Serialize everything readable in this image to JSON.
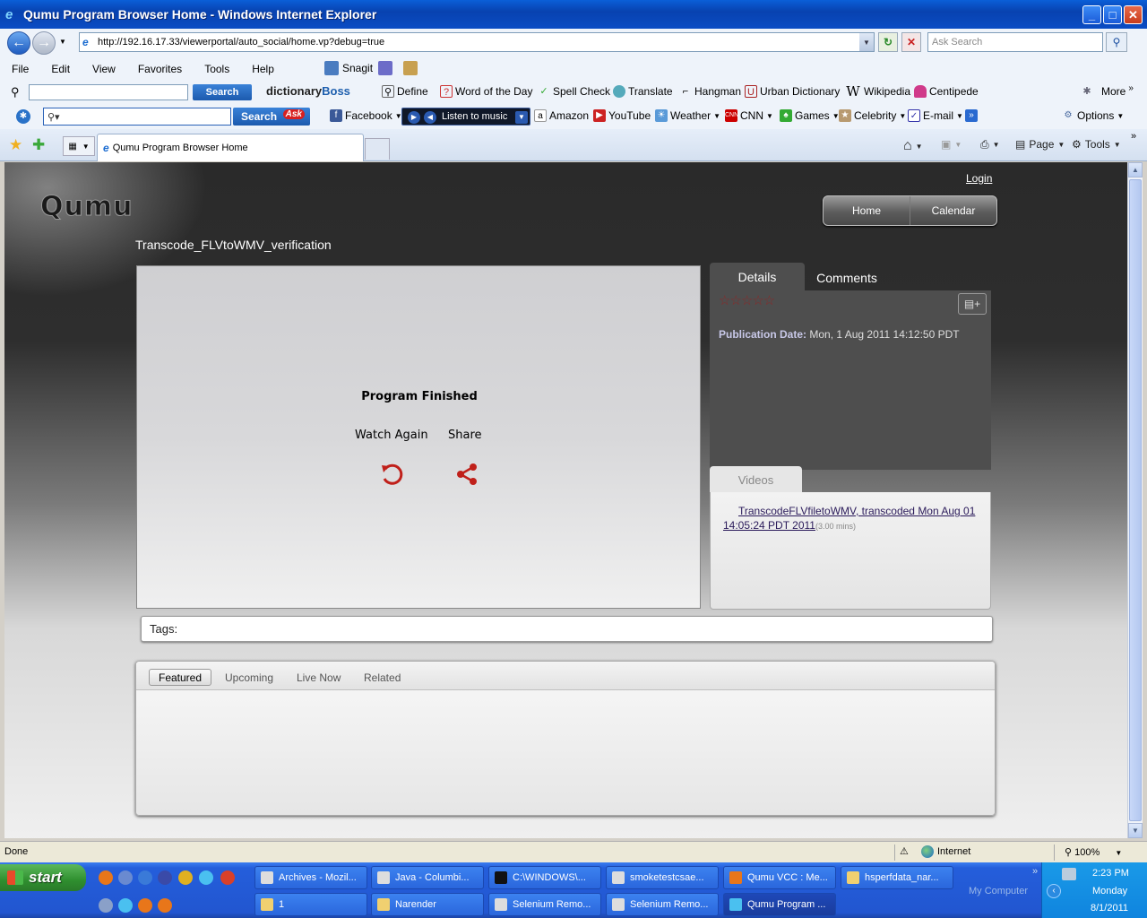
{
  "window": {
    "title": "Qumu Program Browser Home - Windows Internet Explorer",
    "minimize": "_",
    "maximize": "□",
    "close": "✕"
  },
  "addressbar": {
    "url": "http://192.16.17.33/viewerportal/auto_social/home.vp?debug=true",
    "search_placeholder": "Ask Search"
  },
  "menu": [
    "File",
    "Edit",
    "View",
    "Favorites",
    "Tools",
    "Help"
  ],
  "snagit_label": "Snagit",
  "dict_toolbar": {
    "search_button": "Search",
    "brand_a": "dictionary",
    "brand_b": "Boss",
    "tools": [
      "Define",
      "Word of the Day",
      "Spell Check",
      "Translate",
      "Hangman",
      "Urban Dictionary",
      "Wikipedia",
      "Centipede"
    ],
    "more": "More"
  },
  "ask_toolbar": {
    "search_button": "Search",
    "ask_badge": "Ask",
    "facebook": "Facebook",
    "music": "Listen to music",
    "links": [
      "Amazon",
      "YouTube",
      "Weather",
      "CNN",
      "Games",
      "Celebrity",
      "E-mail"
    ],
    "options": "Options"
  },
  "tabbar": {
    "tab_title": "Qumu Program Browser Home",
    "page": "Page",
    "tools": "Tools"
  },
  "page": {
    "logo": "Qumu",
    "login": "Login",
    "nav": [
      "Home",
      "Calendar"
    ],
    "program_title": "Transcode_FLVtoWMV_verification",
    "player": {
      "status": "Program Finished",
      "watch_again": "Watch Again",
      "share": "Share"
    },
    "details": {
      "tab_details": "Details",
      "tab_comments": "Comments",
      "rating_stars": "☆☆☆☆☆",
      "pub_label": "Publication Date:",
      "pub_value": "Mon, 1 Aug 2011 14:12:50 PDT",
      "videos_tab": "Videos",
      "video_link": "TranscodeFLVfiletoWMV, transcoded Mon Aug 01 14:05:24 PDT 2011",
      "video_duration": "(3.00 mins)"
    },
    "tags_label": "Tags:",
    "feature_tabs": [
      "Featured",
      "Upcoming",
      "Live Now",
      "Related"
    ]
  },
  "statusbar": {
    "status": "Done",
    "zone": "Internet",
    "zoom": "100%"
  },
  "taskbar": {
    "start": "start",
    "row1": [
      "Archives - Mozil...",
      "Java - Columbi...",
      "C:\\WINDOWS\\...",
      "smoketestcsae...",
      "Qumu VCC : Me...",
      "hsperfdata_nar..."
    ],
    "row2": [
      "1",
      "Narender",
      "Selenium Remo...",
      "Selenium Remo...",
      "Qumu Program ..."
    ],
    "my_computer": "My Computer",
    "time": "2:23 PM",
    "day": "Monday",
    "date": "8/1/2011"
  },
  "colors": {
    "accent_red": "#c0201a",
    "ie_blue": "#0a4cc4"
  }
}
